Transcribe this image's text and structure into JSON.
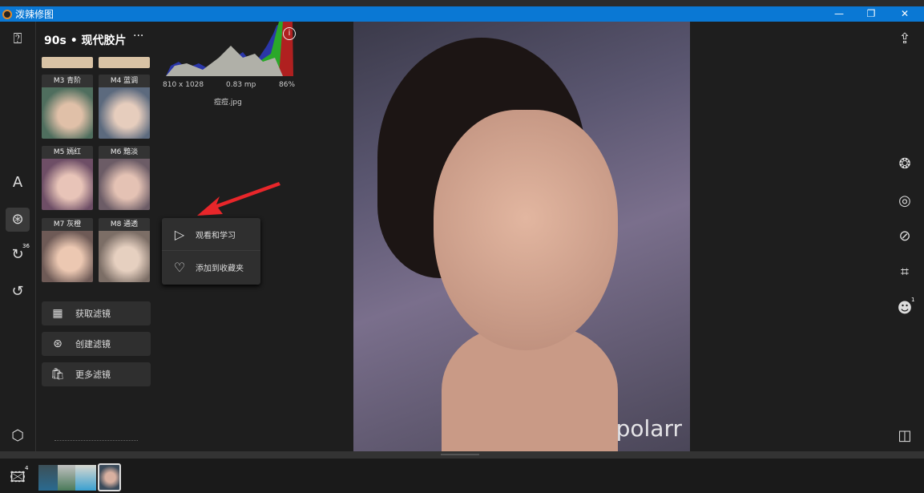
{
  "app": {
    "title": "泼辣修图",
    "window_buttons": [
      "—",
      "❐",
      "✕"
    ]
  },
  "left_toolbar": {
    "items": [
      {
        "name": "import-icon",
        "glyph": "⍰"
      },
      {
        "name": "text-icon",
        "glyph": "A"
      },
      {
        "name": "filters-icon",
        "glyph": "⊛"
      },
      {
        "name": "history-icon",
        "glyph": "↻",
        "badge": "36"
      },
      {
        "name": "reset-icon",
        "glyph": "↺"
      },
      {
        "name": "settings-icon",
        "glyph": "⬡"
      }
    ]
  },
  "filter_panel": {
    "title": "90s • 现代胶片",
    "more": "···",
    "filters": [
      {
        "label": "M3 青阶",
        "color": "#4f6e5e"
      },
      {
        "label": "M4 蓝调",
        "color": "#5c6a7e"
      },
      {
        "label": "M5 嫣红",
        "color": "#6e4e66"
      },
      {
        "label": "M6 黯淡",
        "color": "#6c5c66"
      },
      {
        "label": "M7 灰橙",
        "color": "#6e5a56"
      },
      {
        "label": "M8 通透",
        "color": "#7c6e66"
      }
    ],
    "buttons": [
      {
        "icon": "qr-icon",
        "glyph": "▦",
        "label": "获取滤镜"
      },
      {
        "icon": "create-filter-icon",
        "glyph": "⊛",
        "label": "创建滤镜"
      },
      {
        "icon": "bag-icon",
        "glyph": "🛍",
        "label": "更多滤镜"
      }
    ]
  },
  "histogram": {
    "dimensions": "810 x 1028",
    "megapixels": "0.83 mp",
    "zoom": "86%",
    "filename": "痘痘.jpg",
    "info": "i"
  },
  "context_menu": {
    "items": [
      {
        "icon": "play-icon",
        "glyph": "▷",
        "label": "观看和学习"
      },
      {
        "icon": "heart-icon",
        "glyph": "♡",
        "label": "添加到收藏夹"
      }
    ]
  },
  "photo": {
    "watermark": "polarr"
  },
  "right_toolbar": {
    "face_badge": "1"
  },
  "filmstrip": {
    "count": "4"
  }
}
